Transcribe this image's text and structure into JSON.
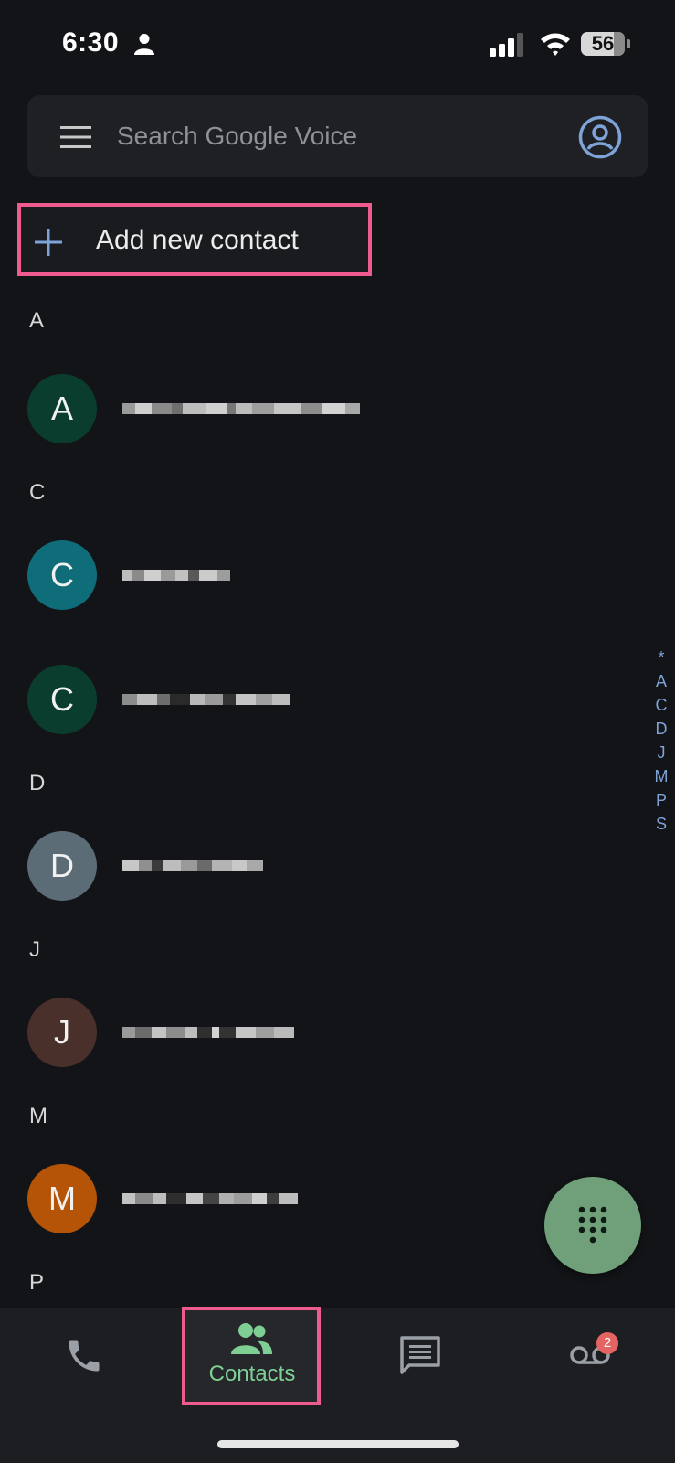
{
  "status_bar": {
    "time": "6:30",
    "battery": "56"
  },
  "search": {
    "placeholder": "Search Google Voice"
  },
  "add_contact": {
    "label": "Add new contact"
  },
  "sections": [
    {
      "letter": "A",
      "contacts": [
        {
          "initial": "A",
          "color": "#0b3d2e"
        }
      ]
    },
    {
      "letter": "C",
      "contacts": [
        {
          "initial": "C",
          "color": "#0f6c79"
        },
        {
          "initial": "C",
          "color": "#0b3d2e"
        }
      ]
    },
    {
      "letter": "D",
      "contacts": [
        {
          "initial": "D",
          "color": "#5b6c77"
        }
      ]
    },
    {
      "letter": "J",
      "contacts": [
        {
          "initial": "J",
          "color": "#4a302a"
        }
      ]
    },
    {
      "letter": "M",
      "contacts": [
        {
          "initial": "M",
          "color": "#b55406"
        }
      ]
    },
    {
      "letter": "P",
      "contacts": []
    }
  ],
  "alpha_index": [
    "*",
    "A",
    "C",
    "D",
    "J",
    "M",
    "P",
    "S"
  ],
  "bottom_nav": {
    "contacts_label": "Contacts",
    "voicemail_badge": "2"
  },
  "colors": {
    "accent_green": "#7fcf95",
    "highlight_pink": "#ef5b8f",
    "fab_green": "#6fa07a",
    "index_blue": "#7ea3d8"
  }
}
